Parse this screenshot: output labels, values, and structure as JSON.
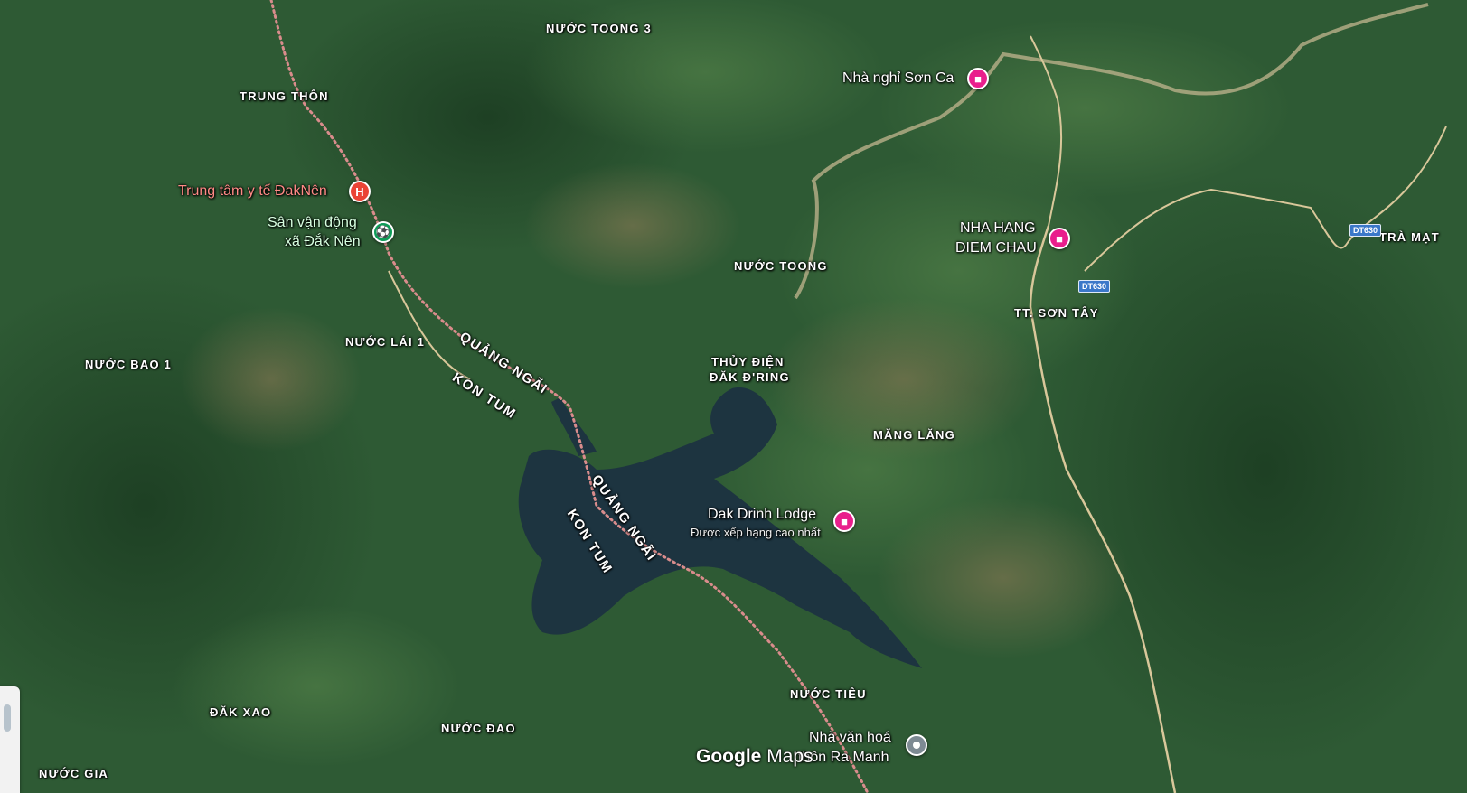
{
  "map": {
    "type": "satellite",
    "colors": {
      "forest": "#2f5a33",
      "forest_dark": "#1f4426",
      "lake": "#1e3340",
      "road": "#d9c79a",
      "border": "#d98c8c"
    },
    "place_labels": [
      {
        "id": "nuoc-toong-3",
        "text": "NƯỚC TOONG 3"
      },
      {
        "id": "trung-thon",
        "text": "TRUNG THÔN"
      },
      {
        "id": "nuoc-toong",
        "text": "NƯỚC TOONG"
      },
      {
        "id": "nuoc-lai-1",
        "text": "NƯỚC LÁI 1"
      },
      {
        "id": "nuoc-bao-1",
        "text": "NƯỚC BAO 1"
      },
      {
        "id": "thuy-dien-1",
        "text": "THỦY ĐIỆN"
      },
      {
        "id": "thuy-dien-2",
        "text": "ĐĂK Đ'RING"
      },
      {
        "id": "mang-lang",
        "text": "MĂNG LĂNG"
      },
      {
        "id": "tt-son-tay",
        "text": "TT. SƠN TÂY"
      },
      {
        "id": "tra-mat",
        "text": "TRÀ MẠT"
      },
      {
        "id": "nuoc-tieu",
        "text": "NƯỚC TIÊU"
      },
      {
        "id": "dak-xao",
        "text": "ĐĂK XAO"
      },
      {
        "id": "nuoc-dao",
        "text": "NƯỚC ĐAO"
      },
      {
        "id": "nuoc-gia",
        "text": "NƯỚC GIA"
      }
    ],
    "border_labels": [
      {
        "id": "quang-ngai-1",
        "text": "QUẢNG NGÃI"
      },
      {
        "id": "kon-tum-1",
        "text": "KON TUM"
      },
      {
        "id": "quang-ngai-2",
        "text": "QUẢNG NGÃI"
      },
      {
        "id": "kon-tum-2",
        "text": "KON TUM"
      }
    ],
    "pois": [
      {
        "id": "nha-nghi-son-ca",
        "name": "Nhà nghỉ Sơn Ca",
        "icon": "hotel-icon"
      },
      {
        "id": "trung-tam-y-te",
        "name": "Trung tâm y tế ĐakNên",
        "icon": "hospital-icon",
        "glyph": "H"
      },
      {
        "id": "san-van-dong",
        "name_line1": "Sân vận động",
        "name_line2": "xã Đắk Nên",
        "icon": "stadium-icon"
      },
      {
        "id": "nha-hang",
        "name_line1": "NHA HANG",
        "name_line2": "DIEM CHAU",
        "icon": "hotel-icon"
      },
      {
        "id": "dak-drinh-lodge",
        "name": "Dak Drinh Lodge",
        "subtitle": "Được xếp hạng cao nhất",
        "icon": "hotel-icon"
      },
      {
        "id": "nha-van-hoa",
        "name_line1": "Nhà văn hoá",
        "name_line2": "thôn Ra Manh",
        "icon": "landmark-icon"
      }
    ],
    "road_shields": [
      {
        "id": "dt630-a",
        "text": "DT630"
      },
      {
        "id": "dt630-b",
        "text": "DT630"
      }
    ],
    "logo": {
      "google": "Google",
      "maps": "Maps"
    }
  }
}
